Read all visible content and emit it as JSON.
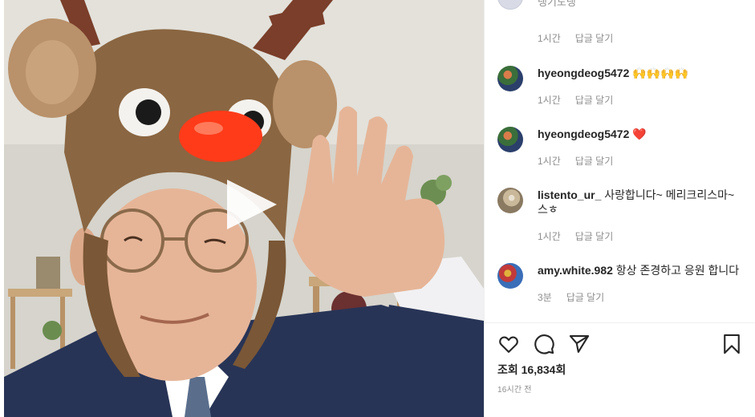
{
  "comments_panel": {
    "clipped_top": {
      "text": "댕기도댕"
    },
    "first_meta": {
      "time": "1시간",
      "reply": "답글 달기"
    },
    "items": [
      {
        "username": "hyeongdeog5472",
        "text": "🙌🙌🙌🙌",
        "time": "1시간",
        "reply": "답글 달기"
      },
      {
        "username": "hyeongdeog5472",
        "text": "❤️",
        "time": "1시간",
        "reply": "답글 달기"
      },
      {
        "username": "listento_ur_",
        "text": "사랑합니다~ 메리크리스마~스ㅎ",
        "time": "1시간",
        "reply": "답글 달기"
      },
      {
        "username": "amy.white.982",
        "text": "항상 존경하고 응원 합니다",
        "time": "3분",
        "reply": "답글 달기"
      }
    ]
  },
  "actions": {
    "like_icon": "heart-icon",
    "comment_icon": "comment-bubble-icon",
    "share_icon": "paper-plane-icon",
    "save_icon": "bookmark-icon"
  },
  "stats": {
    "views": "조회 16,834회",
    "posted": "16시간 전"
  },
  "video": {
    "play_icon": "play-icon"
  }
}
